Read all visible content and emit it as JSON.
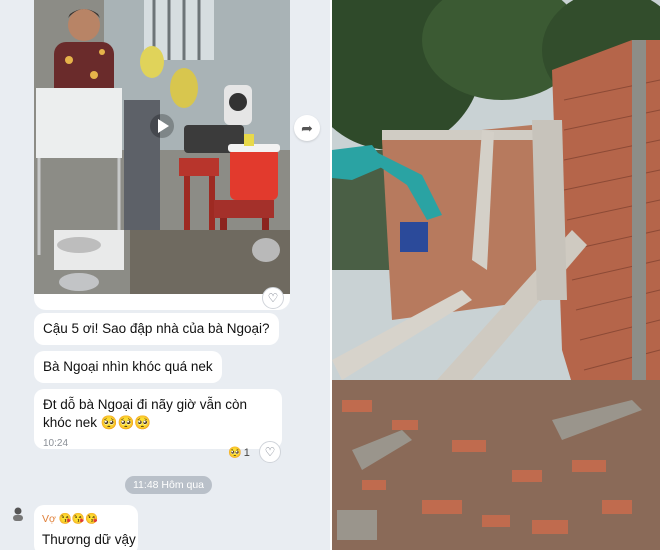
{
  "chat": {
    "photo_alt": "Bà Ngoại trong nhà",
    "messages": [
      {
        "text": "Cậu 5 ơi! Sao đập nhà của bà Ngoại?"
      },
      {
        "text": "Bà Ngoại nhìn khóc quá nek"
      },
      {
        "text": "Đt dỗ bà Ngoại đi nãy giờ vẫn còn khóc nek 🥺🥺🥺",
        "time": "10:24"
      }
    ],
    "reaction": {
      "emoji": "🥺",
      "count": "1"
    },
    "date_separator": "11:48 Hôm qua",
    "reply": {
      "sender": "Vợ 😘😘😘",
      "text": "Thương dữ vậy"
    }
  },
  "icons": {
    "heart": "heart-icon",
    "share": "share-arrow-icon",
    "avatar": "avatar-icon"
  },
  "colors": {
    "chat_bg": "#e9edf2",
    "bubble_bg": "#ffffff",
    "sender_name": "#e0803a",
    "excavator": "#2aa3a3"
  }
}
